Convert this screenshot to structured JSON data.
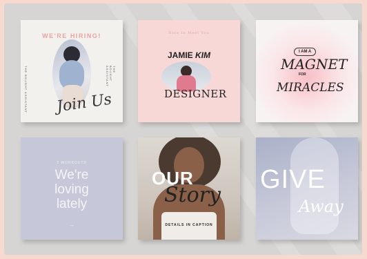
{
  "cards": [
    {
      "id": "we-are-hiring",
      "heading": "WE'RE HIRING!",
      "side_text": "THE BOUGHT ASSISTANT",
      "script_text": "Join Us"
    },
    {
      "id": "designer",
      "top_text": "Nice to Meet You",
      "name_first": "JAMIE",
      "name_last": "KIM",
      "role": "DESIGNER"
    },
    {
      "id": "magnet",
      "badge": "I AM A",
      "line1": "MAGNET",
      "line2": "FOR",
      "line3": "MIRACLES"
    },
    {
      "id": "loving-lately",
      "small": "3 WORKOUTS",
      "big_line1": "We're",
      "big_line2": "loving",
      "big_line3": "lately",
      "arrow": "→"
    },
    {
      "id": "our-story",
      "line1": "OUR",
      "line2": "Story",
      "caption": "DETAILS IN CAPTION"
    },
    {
      "id": "give-away",
      "line1": "GIVE",
      "line2": "Away"
    }
  ]
}
